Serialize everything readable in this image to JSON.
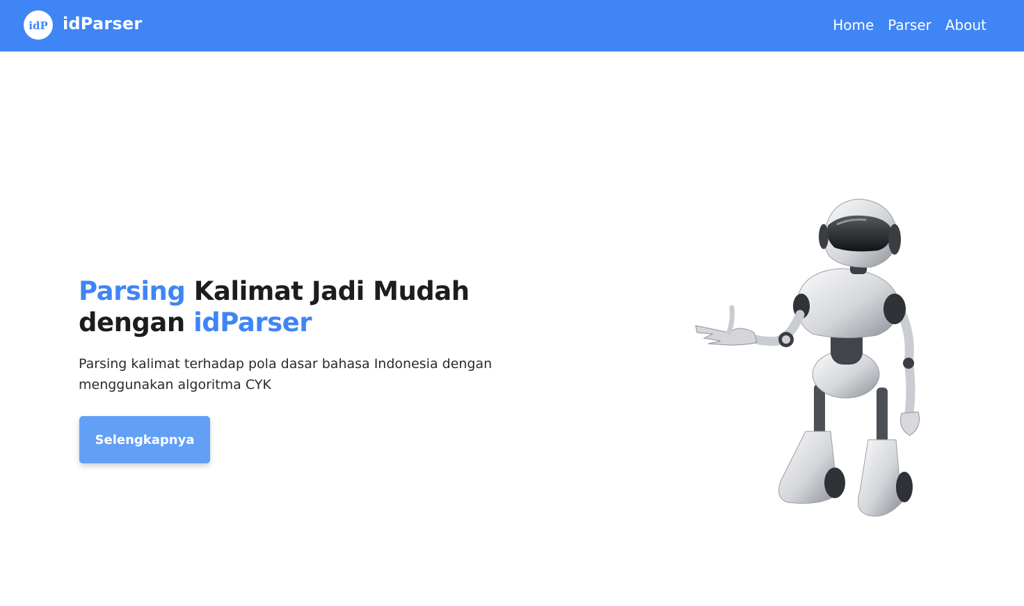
{
  "navbar": {
    "brand_logo_text": "idP",
    "brand_name": "idParser",
    "links": [
      "Home",
      "Parser",
      "About"
    ],
    "color": "#3f85f5"
  },
  "hero": {
    "title_highlight_1": "Parsing",
    "title_plain_1": " Kalimat Jadi Mudah",
    "title_plain_2": "dengan ",
    "title_highlight_2": "idParser",
    "description": "Parsing kalimat terhadap pola dasar bahasa Indonesia dengan menggunakan algoritma CYK",
    "button_label": "Selengkapnya",
    "accent_color": "#3f85f5",
    "button_color": "#62a0f6"
  },
  "illustration": {
    "icon": "robot-illustration"
  }
}
